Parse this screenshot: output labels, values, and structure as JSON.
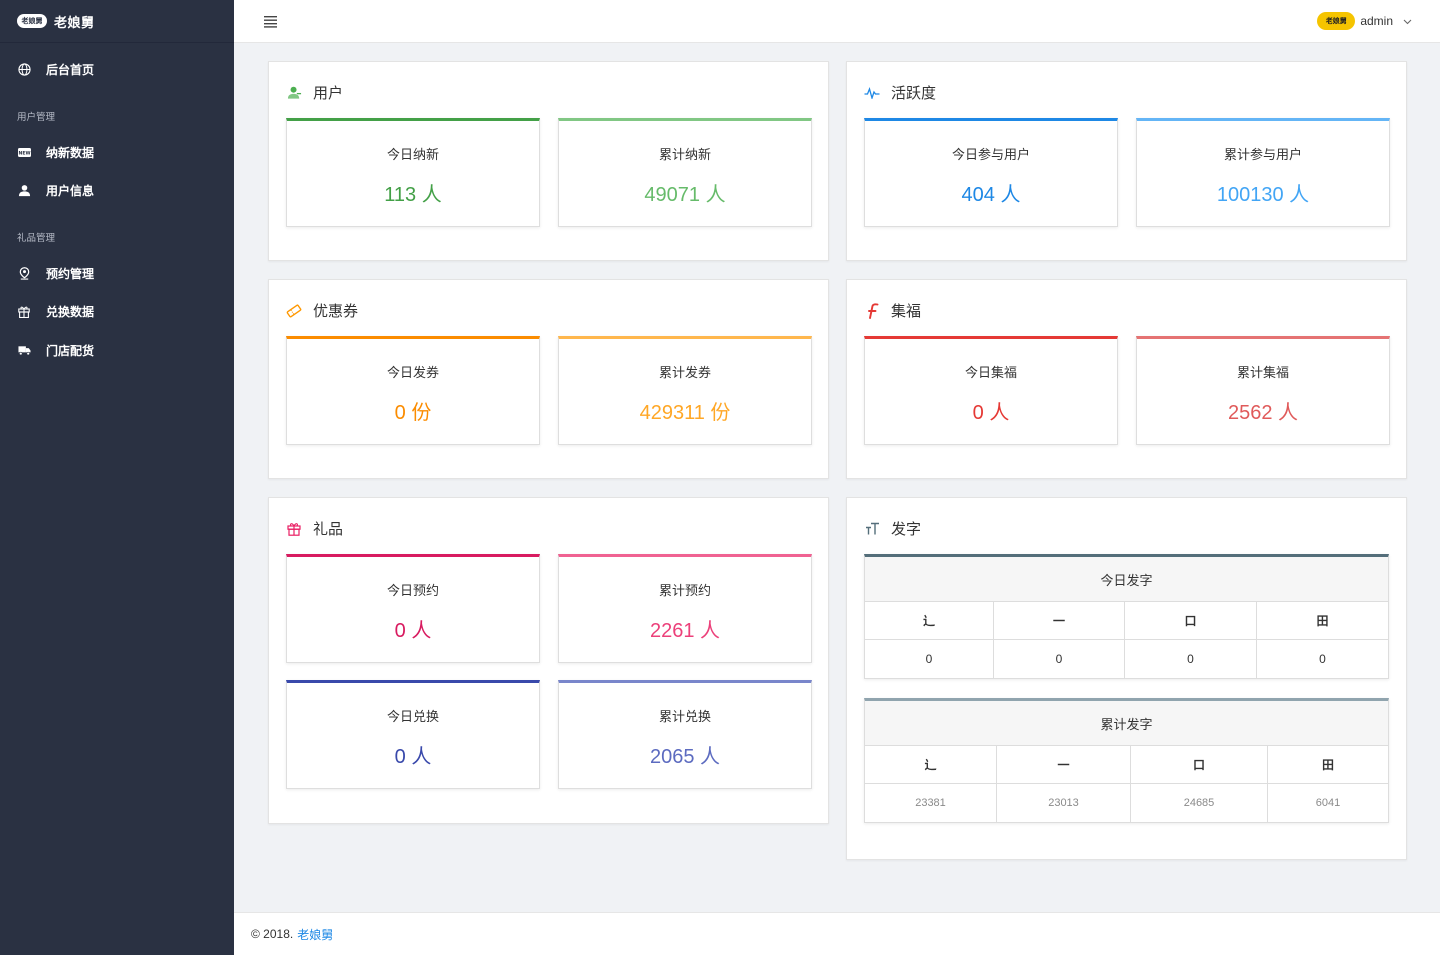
{
  "brand": {
    "logo": "老娘舅",
    "name": "老娘舅"
  },
  "sidebar": {
    "home": {
      "label": "后台首页"
    },
    "groups": [
      {
        "title": "用户管理",
        "items": [
          {
            "label": "纳新数据",
            "icon": "new-badge-icon"
          },
          {
            "label": "用户信息",
            "icon": "user-info-icon"
          }
        ]
      },
      {
        "title": "礼品管理",
        "items": [
          {
            "label": "预约管理",
            "icon": "map-pin-icon"
          },
          {
            "label": "兑换数据",
            "icon": "gift-icon"
          },
          {
            "label": "门店配货",
            "icon": "truck-icon"
          }
        ]
      }
    ]
  },
  "header": {
    "avatar": "老娘舅",
    "user": "admin"
  },
  "panels": {
    "user": {
      "title": "用户",
      "color": "#4caf50",
      "cards": [
        {
          "label": "今日纳新",
          "value": "113 人"
        },
        {
          "label": "累计纳新",
          "value": "49071 人"
        }
      ]
    },
    "activity": {
      "title": "活跃度",
      "color": "#1e88e5",
      "cards": [
        {
          "label": "今日参与用户",
          "value": "404 人"
        },
        {
          "label": "累计参与用户",
          "value": "100130 人"
        }
      ]
    },
    "coupon": {
      "title": "优惠券",
      "color": "#ff9800",
      "cards": [
        {
          "label": "今日发券",
          "value": "0 份"
        },
        {
          "label": "累计发券",
          "value": "429311 份"
        }
      ]
    },
    "fortune": {
      "title": "集福",
      "color": "#e53935",
      "cards": [
        {
          "label": "今日集福",
          "value": "0 人"
        },
        {
          "label": "累计集福",
          "value": "2562 人"
        }
      ]
    },
    "gift": {
      "title": "礼品",
      "color": "#e91e63",
      "cards": [
        {
          "label": "今日预约",
          "value": "0 人"
        },
        {
          "label": "累计预约",
          "value": "2261 人"
        },
        {
          "label": "今日兑换",
          "value": "0 人"
        },
        {
          "label": "累计兑换",
          "value": "2065 人"
        }
      ]
    },
    "words": {
      "title": "发字",
      "today": {
        "title": "今日发字",
        "headers": [
          "⻌",
          "一",
          "口",
          "田"
        ],
        "values": [
          "0",
          "0",
          "0",
          "0"
        ]
      },
      "total": {
        "title": "累计发字",
        "headers": [
          "⻌",
          "一",
          "口",
          "田"
        ],
        "values": [
          "23381",
          "23013",
          "24685",
          "6041"
        ]
      }
    }
  },
  "colors": {
    "user_today": "#43a047",
    "user_total": "#81c784",
    "act_today": "#1e88e5",
    "act_total": "#64b5f6",
    "coupon_today": "#fb8c00",
    "coupon_total": "#ffb74d",
    "fortune_today": "#e53935",
    "fortune_total": "#e57373",
    "gift_r_today": "#d81b60",
    "gift_r_total": "#f06292",
    "gift_x_today": "#3949ab",
    "gift_x_total": "#7986cb",
    "words_today": "#546e7a",
    "words_total": "#90a4ae"
  },
  "footer": {
    "copyright": "© 2018.",
    "link": "老娘舅"
  }
}
